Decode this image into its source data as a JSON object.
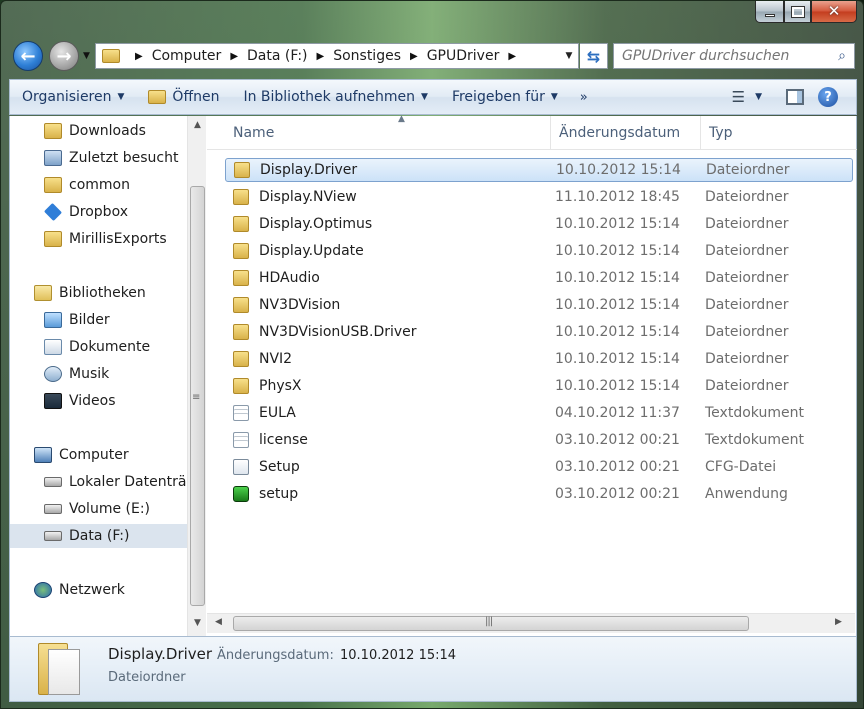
{
  "address": {
    "crumbs": [
      "Computer",
      "Data (F:)",
      "Sonstiges",
      "GPUDriver"
    ]
  },
  "search": {
    "placeholder": "GPUDriver durchsuchen"
  },
  "toolbar": {
    "organize": "Organisieren",
    "open": "Öffnen",
    "library": "In Bibliothek aufnehmen",
    "share": "Freigeben für",
    "more": "»"
  },
  "nav": {
    "favorites": [
      "Downloads",
      "Zuletzt besucht",
      "common",
      "Dropbox",
      "MirillisExports"
    ],
    "libraries_label": "Bibliotheken",
    "libraries": [
      "Bilder",
      "Dokumente",
      "Musik",
      "Videos"
    ],
    "computer_label": "Computer",
    "drives": [
      "Lokaler Datenträger",
      "Volume (E:)",
      "Data (F:)"
    ],
    "network_label": "Netzwerk"
  },
  "columns": {
    "name": "Name",
    "date": "Änderungsdatum",
    "type": "Typ"
  },
  "files": [
    {
      "name": "Display.Driver",
      "date": "10.10.2012 15:14",
      "type": "Dateiordner",
      "icon": "folder-icon"
    },
    {
      "name": "Display.NView",
      "date": "11.10.2012 18:45",
      "type": "Dateiordner",
      "icon": "folder-icon"
    },
    {
      "name": "Display.Optimus",
      "date": "10.10.2012 15:14",
      "type": "Dateiordner",
      "icon": "folder-icon"
    },
    {
      "name": "Display.Update",
      "date": "10.10.2012 15:14",
      "type": "Dateiordner",
      "icon": "folder-icon"
    },
    {
      "name": "HDAudio",
      "date": "10.10.2012 15:14",
      "type": "Dateiordner",
      "icon": "folder-icon"
    },
    {
      "name": "NV3DVision",
      "date": "10.10.2012 15:14",
      "type": "Dateiordner",
      "icon": "folder-icon"
    },
    {
      "name": "NV3DVisionUSB.Driver",
      "date": "10.10.2012 15:14",
      "type": "Dateiordner",
      "icon": "folder-icon"
    },
    {
      "name": "NVI2",
      "date": "10.10.2012 15:14",
      "type": "Dateiordner",
      "icon": "folder-icon"
    },
    {
      "name": "PhysX",
      "date": "10.10.2012 15:14",
      "type": "Dateiordner",
      "icon": "folder-icon"
    },
    {
      "name": "EULA",
      "date": "04.10.2012 11:37",
      "type": "Textdokument",
      "icon": "text-document-icon"
    },
    {
      "name": "license",
      "date": "03.10.2012 00:21",
      "type": "Textdokument",
      "icon": "text-document-icon"
    },
    {
      "name": "Setup",
      "date": "03.10.2012 00:21",
      "type": "CFG-Datei",
      "icon": "config-file-icon"
    },
    {
      "name": "setup",
      "date": "03.10.2012 00:21",
      "type": "Anwendung",
      "icon": "application-icon"
    }
  ],
  "details": {
    "name": "Display.Driver",
    "date_label": "Änderungsdatum:",
    "date_value": "10.10.2012 15:14",
    "type": "Dateiordner"
  }
}
